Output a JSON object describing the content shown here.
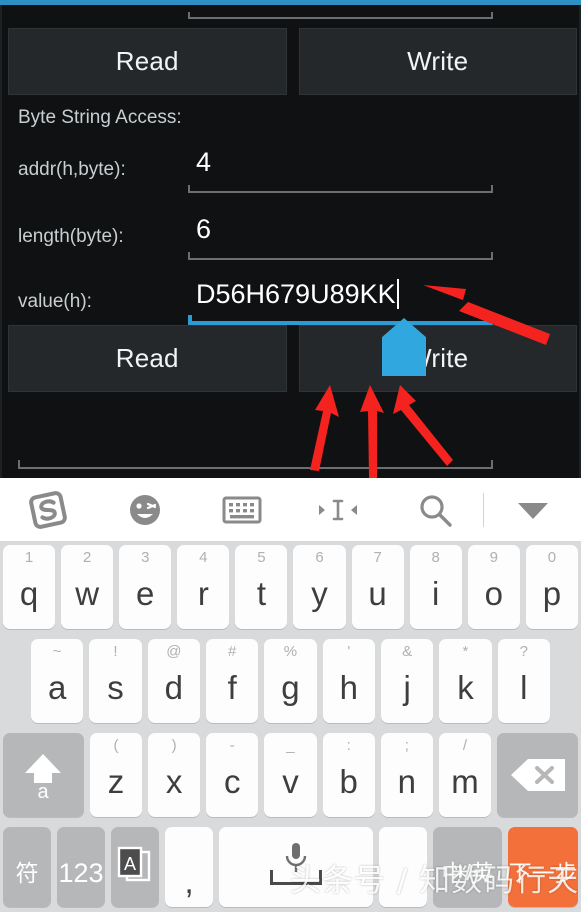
{
  "app": {
    "accent_bar_color": "#2d8fc4",
    "background_color": "#0f1112",
    "buttons_top": {
      "read_label": "Read",
      "write_label": "Write"
    },
    "section_label": "Byte String Access:",
    "fields": [
      {
        "label": "addr(h,byte):",
        "value": "4",
        "focused": false
      },
      {
        "label": "length(byte):",
        "value": "6",
        "focused": false
      },
      {
        "label": "value(h):",
        "value": "D56H679U89KK",
        "focused": true
      }
    ],
    "buttons_bottom": {
      "read_label": "Read",
      "write_label": "Write"
    }
  },
  "keyboard": {
    "toolbar": [
      {
        "name": "sogou-logo-icon",
        "label": "S"
      },
      {
        "name": "emoji-icon",
        "label": "emoji"
      },
      {
        "name": "keyboard-icon",
        "label": "keyboard"
      },
      {
        "name": "cursor-move-icon",
        "label": "cursor"
      },
      {
        "name": "search-icon",
        "label": "search"
      },
      {
        "name": "chevron-down-icon",
        "label": "collapse"
      }
    ],
    "row1": [
      {
        "key": "q",
        "hint": "1"
      },
      {
        "key": "w",
        "hint": "2"
      },
      {
        "key": "e",
        "hint": "3"
      },
      {
        "key": "r",
        "hint": "4"
      },
      {
        "key": "t",
        "hint": "5"
      },
      {
        "key": "y",
        "hint": "6"
      },
      {
        "key": "u",
        "hint": "7"
      },
      {
        "key": "i",
        "hint": "8"
      },
      {
        "key": "o",
        "hint": "9"
      },
      {
        "key": "p",
        "hint": "0"
      }
    ],
    "row2": [
      {
        "key": "a",
        "hint": "~"
      },
      {
        "key": "s",
        "hint": "!"
      },
      {
        "key": "d",
        "hint": "@"
      },
      {
        "key": "f",
        "hint": "#"
      },
      {
        "key": "g",
        "hint": "%"
      },
      {
        "key": "h",
        "hint": "'"
      },
      {
        "key": "j",
        "hint": "&"
      },
      {
        "key": "k",
        "hint": "*"
      },
      {
        "key": "l",
        "hint": "?"
      }
    ],
    "row3": [
      {
        "key": "z",
        "hint": "("
      },
      {
        "key": "x",
        "hint": ")"
      },
      {
        "key": "c",
        "hint": "-"
      },
      {
        "key": "v",
        "hint": "_"
      },
      {
        "key": "b",
        "hint": ":"
      },
      {
        "key": "n",
        "hint": ";"
      },
      {
        "key": "m",
        "hint": "/"
      }
    ],
    "shift_label": "a",
    "backspace_label": "×",
    "row4": {
      "symbol_label": "符",
      "numeric_label": "123",
      "translate_label": "A",
      "comma_label": ",",
      "space_label": "",
      "period_label": "",
      "lang_label": "中/英",
      "enter_label": "下一步"
    },
    "accent_color": "#f3703a",
    "fn_key_color": "#b6b7b8"
  },
  "annotations": {
    "arrow_color": "#f4231f",
    "cursor_handle_color": "#31a7e0",
    "arrow_count": 4
  },
  "watermark": {
    "text": "头条号 / 知数码行天下"
  }
}
